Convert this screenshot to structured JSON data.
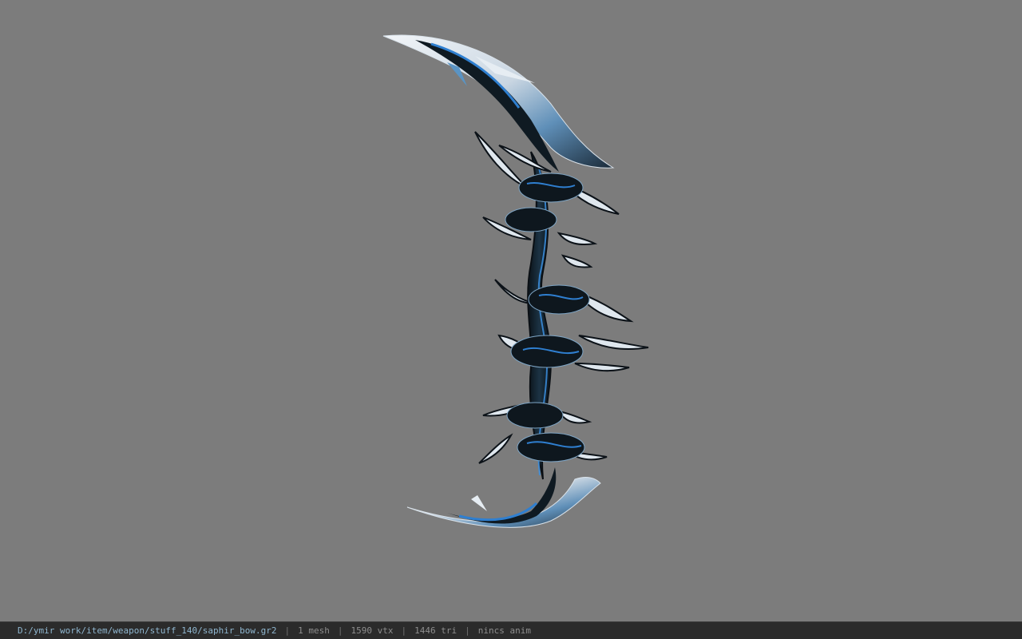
{
  "viewer": {
    "background_color": "#7c7c7c",
    "model_name": "saphir_bow",
    "model_icon": "bow-model",
    "accent_colors": {
      "blade": "#dfe7ee",
      "dark": "#101820",
      "glow": "#2f7fd0"
    }
  },
  "statusbar": {
    "path": "D:/ymir work/item/weapon/stuff_140/saphir_bow.gr2",
    "sep1": "|",
    "mesh": "1 mesh",
    "sep2": "|",
    "vtx": "1590 vtx",
    "sep3": "|",
    "tri": "1446 tri",
    "sep4": "|",
    "anim": "nincs anim"
  }
}
